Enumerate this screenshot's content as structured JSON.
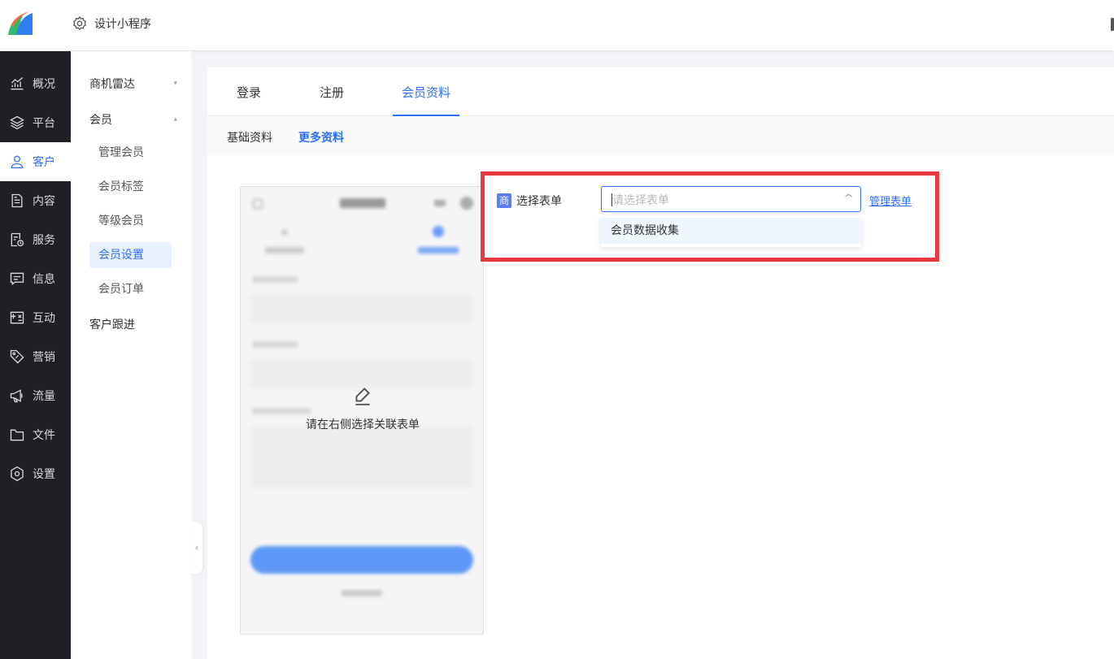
{
  "header": {
    "design_label": "设计小程序"
  },
  "sidebar": {
    "items": [
      {
        "label": "概况",
        "icon": "chart-line-icon"
      },
      {
        "label": "平台",
        "icon": "layers-icon"
      },
      {
        "label": "客户",
        "icon": "user-icon",
        "active": true
      },
      {
        "label": "内容",
        "icon": "document-icon"
      },
      {
        "label": "服务",
        "icon": "service-icon"
      },
      {
        "label": "信息",
        "icon": "message-icon"
      },
      {
        "label": "互动",
        "icon": "interaction-icon"
      },
      {
        "label": "营销",
        "icon": "tag-icon"
      },
      {
        "label": "流量",
        "icon": "megaphone-icon"
      },
      {
        "label": "文件",
        "icon": "folder-icon"
      },
      {
        "label": "设置",
        "icon": "settings-icon"
      }
    ],
    "accent_color": "#2f6ff2",
    "background_color": "#1f2026"
  },
  "submenu": {
    "group_radar": "商机雷达",
    "group_member": "会员",
    "items": [
      "管理会员",
      "会员标签",
      "等级会员",
      "会员设置",
      "会员订单"
    ],
    "active_item": "会员设置",
    "group_followup": "客户跟进"
  },
  "tabs": [
    "登录",
    "注册",
    "会员资料"
  ],
  "active_tab": "会员资料",
  "subtabs": [
    "基础资料",
    "更多资料"
  ],
  "active_subtab": "更多资料",
  "preview": {
    "hint": "请在右侧选择关联表单",
    "edit_icon": "edit-icon"
  },
  "form": {
    "badge": "商",
    "label": "选择表单",
    "placeholder": "请选择表单",
    "manage_link": "管理表单",
    "options": [
      "会员数据收集"
    ]
  },
  "highlight_color": "#e73a3e"
}
